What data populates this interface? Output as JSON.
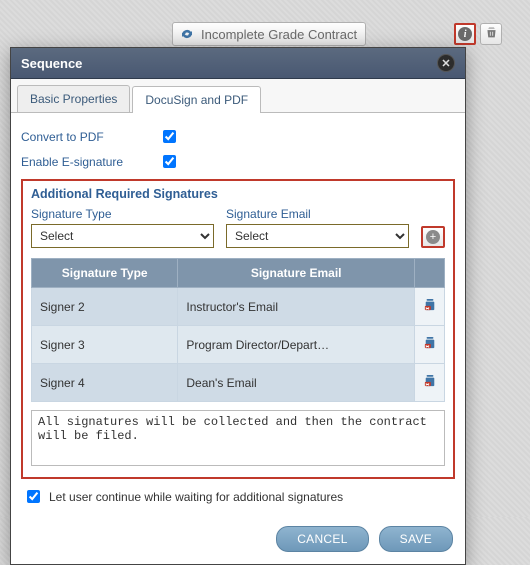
{
  "toolbar": {
    "chip_label": "Incomplete Grade Contract"
  },
  "dialog": {
    "title": "Sequence",
    "tabs": {
      "basic": "Basic Properties",
      "docusign": "DocuSign and PDF"
    },
    "convert_label": "Convert to PDF",
    "esign_label": "Enable E-signature",
    "convert_checked": true,
    "esign_checked": true,
    "section_title": "Additional Required Signatures",
    "sig_type_label": "Signature Type",
    "sig_email_label": "Signature Email",
    "select_placeholder": "Select",
    "table": {
      "head_type": "Signature Type",
      "head_email": "Signature Email",
      "rows": [
        {
          "type": "Signer 2",
          "email": "Instructor's Email"
        },
        {
          "type": "Signer 3",
          "email": "Program Director/Depart…"
        },
        {
          "type": "Signer 4",
          "email": "Dean's Email"
        }
      ]
    },
    "note_text": "All signatures will be collected and then the contract will be filed.",
    "continue_label": "Let user continue while waiting for additional signatures",
    "continue_checked": true,
    "cancel_label": "CANCEL",
    "save_label": "SAVE"
  }
}
